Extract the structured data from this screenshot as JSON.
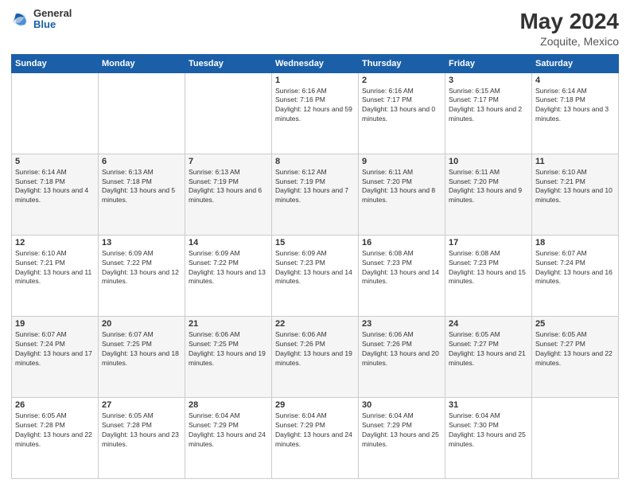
{
  "logo": {
    "general": "General",
    "blue": "Blue"
  },
  "title": "May 2024",
  "location": "Zoquite, Mexico",
  "days_header": [
    "Sunday",
    "Monday",
    "Tuesday",
    "Wednesday",
    "Thursday",
    "Friday",
    "Saturday"
  ],
  "weeks": [
    [
      {
        "day": "",
        "sunrise": "",
        "sunset": "",
        "daylight": ""
      },
      {
        "day": "",
        "sunrise": "",
        "sunset": "",
        "daylight": ""
      },
      {
        "day": "",
        "sunrise": "",
        "sunset": "",
        "daylight": ""
      },
      {
        "day": "1",
        "sunrise": "Sunrise: 6:16 AM",
        "sunset": "Sunset: 7:16 PM",
        "daylight": "Daylight: 12 hours and 59 minutes."
      },
      {
        "day": "2",
        "sunrise": "Sunrise: 6:16 AM",
        "sunset": "Sunset: 7:17 PM",
        "daylight": "Daylight: 13 hours and 0 minutes."
      },
      {
        "day": "3",
        "sunrise": "Sunrise: 6:15 AM",
        "sunset": "Sunset: 7:17 PM",
        "daylight": "Daylight: 13 hours and 2 minutes."
      },
      {
        "day": "4",
        "sunrise": "Sunrise: 6:14 AM",
        "sunset": "Sunset: 7:18 PM",
        "daylight": "Daylight: 13 hours and 3 minutes."
      }
    ],
    [
      {
        "day": "5",
        "sunrise": "Sunrise: 6:14 AM",
        "sunset": "Sunset: 7:18 PM",
        "daylight": "Daylight: 13 hours and 4 minutes."
      },
      {
        "day": "6",
        "sunrise": "Sunrise: 6:13 AM",
        "sunset": "Sunset: 7:18 PM",
        "daylight": "Daylight: 13 hours and 5 minutes."
      },
      {
        "day": "7",
        "sunrise": "Sunrise: 6:13 AM",
        "sunset": "Sunset: 7:19 PM",
        "daylight": "Daylight: 13 hours and 6 minutes."
      },
      {
        "day": "8",
        "sunrise": "Sunrise: 6:12 AM",
        "sunset": "Sunset: 7:19 PM",
        "daylight": "Daylight: 13 hours and 7 minutes."
      },
      {
        "day": "9",
        "sunrise": "Sunrise: 6:11 AM",
        "sunset": "Sunset: 7:20 PM",
        "daylight": "Daylight: 13 hours and 8 minutes."
      },
      {
        "day": "10",
        "sunrise": "Sunrise: 6:11 AM",
        "sunset": "Sunset: 7:20 PM",
        "daylight": "Daylight: 13 hours and 9 minutes."
      },
      {
        "day": "11",
        "sunrise": "Sunrise: 6:10 AM",
        "sunset": "Sunset: 7:21 PM",
        "daylight": "Daylight: 13 hours and 10 minutes."
      }
    ],
    [
      {
        "day": "12",
        "sunrise": "Sunrise: 6:10 AM",
        "sunset": "Sunset: 7:21 PM",
        "daylight": "Daylight: 13 hours and 11 minutes."
      },
      {
        "day": "13",
        "sunrise": "Sunrise: 6:09 AM",
        "sunset": "Sunset: 7:22 PM",
        "daylight": "Daylight: 13 hours and 12 minutes."
      },
      {
        "day": "14",
        "sunrise": "Sunrise: 6:09 AM",
        "sunset": "Sunset: 7:22 PM",
        "daylight": "Daylight: 13 hours and 13 minutes."
      },
      {
        "day": "15",
        "sunrise": "Sunrise: 6:09 AM",
        "sunset": "Sunset: 7:23 PM",
        "daylight": "Daylight: 13 hours and 14 minutes."
      },
      {
        "day": "16",
        "sunrise": "Sunrise: 6:08 AM",
        "sunset": "Sunset: 7:23 PM",
        "daylight": "Daylight: 13 hours and 14 minutes."
      },
      {
        "day": "17",
        "sunrise": "Sunrise: 6:08 AM",
        "sunset": "Sunset: 7:23 PM",
        "daylight": "Daylight: 13 hours and 15 minutes."
      },
      {
        "day": "18",
        "sunrise": "Sunrise: 6:07 AM",
        "sunset": "Sunset: 7:24 PM",
        "daylight": "Daylight: 13 hours and 16 minutes."
      }
    ],
    [
      {
        "day": "19",
        "sunrise": "Sunrise: 6:07 AM",
        "sunset": "Sunset: 7:24 PM",
        "daylight": "Daylight: 13 hours and 17 minutes."
      },
      {
        "day": "20",
        "sunrise": "Sunrise: 6:07 AM",
        "sunset": "Sunset: 7:25 PM",
        "daylight": "Daylight: 13 hours and 18 minutes."
      },
      {
        "day": "21",
        "sunrise": "Sunrise: 6:06 AM",
        "sunset": "Sunset: 7:25 PM",
        "daylight": "Daylight: 13 hours and 19 minutes."
      },
      {
        "day": "22",
        "sunrise": "Sunrise: 6:06 AM",
        "sunset": "Sunset: 7:26 PM",
        "daylight": "Daylight: 13 hours and 19 minutes."
      },
      {
        "day": "23",
        "sunrise": "Sunrise: 6:06 AM",
        "sunset": "Sunset: 7:26 PM",
        "daylight": "Daylight: 13 hours and 20 minutes."
      },
      {
        "day": "24",
        "sunrise": "Sunrise: 6:05 AM",
        "sunset": "Sunset: 7:27 PM",
        "daylight": "Daylight: 13 hours and 21 minutes."
      },
      {
        "day": "25",
        "sunrise": "Sunrise: 6:05 AM",
        "sunset": "Sunset: 7:27 PM",
        "daylight": "Daylight: 13 hours and 22 minutes."
      }
    ],
    [
      {
        "day": "26",
        "sunrise": "Sunrise: 6:05 AM",
        "sunset": "Sunset: 7:28 PM",
        "daylight": "Daylight: 13 hours and 22 minutes."
      },
      {
        "day": "27",
        "sunrise": "Sunrise: 6:05 AM",
        "sunset": "Sunset: 7:28 PM",
        "daylight": "Daylight: 13 hours and 23 minutes."
      },
      {
        "day": "28",
        "sunrise": "Sunrise: 6:04 AM",
        "sunset": "Sunset: 7:29 PM",
        "daylight": "Daylight: 13 hours and 24 minutes."
      },
      {
        "day": "29",
        "sunrise": "Sunrise: 6:04 AM",
        "sunset": "Sunset: 7:29 PM",
        "daylight": "Daylight: 13 hours and 24 minutes."
      },
      {
        "day": "30",
        "sunrise": "Sunrise: 6:04 AM",
        "sunset": "Sunset: 7:29 PM",
        "daylight": "Daylight: 13 hours and 25 minutes."
      },
      {
        "day": "31",
        "sunrise": "Sunrise: 6:04 AM",
        "sunset": "Sunset: 7:30 PM",
        "daylight": "Daylight: 13 hours and 25 minutes."
      },
      {
        "day": "",
        "sunrise": "",
        "sunset": "",
        "daylight": ""
      }
    ]
  ]
}
